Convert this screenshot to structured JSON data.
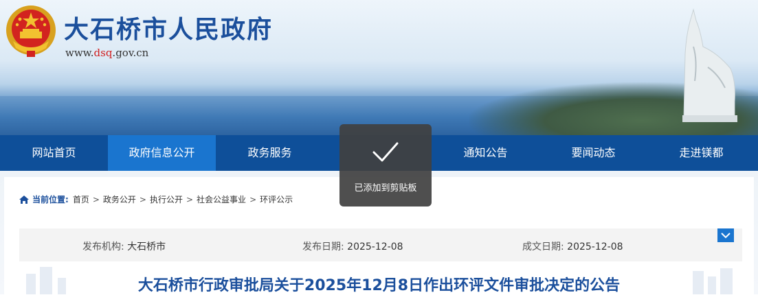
{
  "header": {
    "site_title": "大石桥市人民政府",
    "url_prefix": "www.",
    "url_highlight": "dsq",
    "url_suffix": ".gov.cn",
    "emblem_icon": "national-emblem-icon"
  },
  "nav": {
    "items": [
      {
        "label": "网站首页",
        "active": false
      },
      {
        "label": "政府信息公开",
        "active": true
      },
      {
        "label": "政务服务",
        "active": false
      },
      {
        "label": "",
        "active": false
      },
      {
        "label": "通知公告",
        "active": false
      },
      {
        "label": "要闻动态",
        "active": false
      },
      {
        "label": "走进镁都",
        "active": false
      }
    ]
  },
  "breadcrumb": {
    "label": "当前位置:",
    "items": [
      "首页",
      "政务公开",
      "执行公开",
      "社会公益事业",
      "环评公示"
    ],
    "separator": ">"
  },
  "meta": {
    "publisher_key": "发布机构:",
    "publisher_value": "大石桥市",
    "publish_date_key": "发布日期:",
    "publish_date_value": "2025-12-08",
    "created_date_key": "成文日期:",
    "created_date_value": "2025-12-08"
  },
  "article": {
    "title": "大石桥市行政审批局关于2025年12月8日作出环评文件审批决定的公告"
  },
  "toast": {
    "message": "已添加到剪贴板",
    "icon": "checkmark-icon"
  },
  "colors": {
    "nav_bg": "#0e4f99",
    "nav_active": "#1a75cf",
    "title_blue": "#1b4f9c",
    "url_red": "#d11f1f"
  }
}
